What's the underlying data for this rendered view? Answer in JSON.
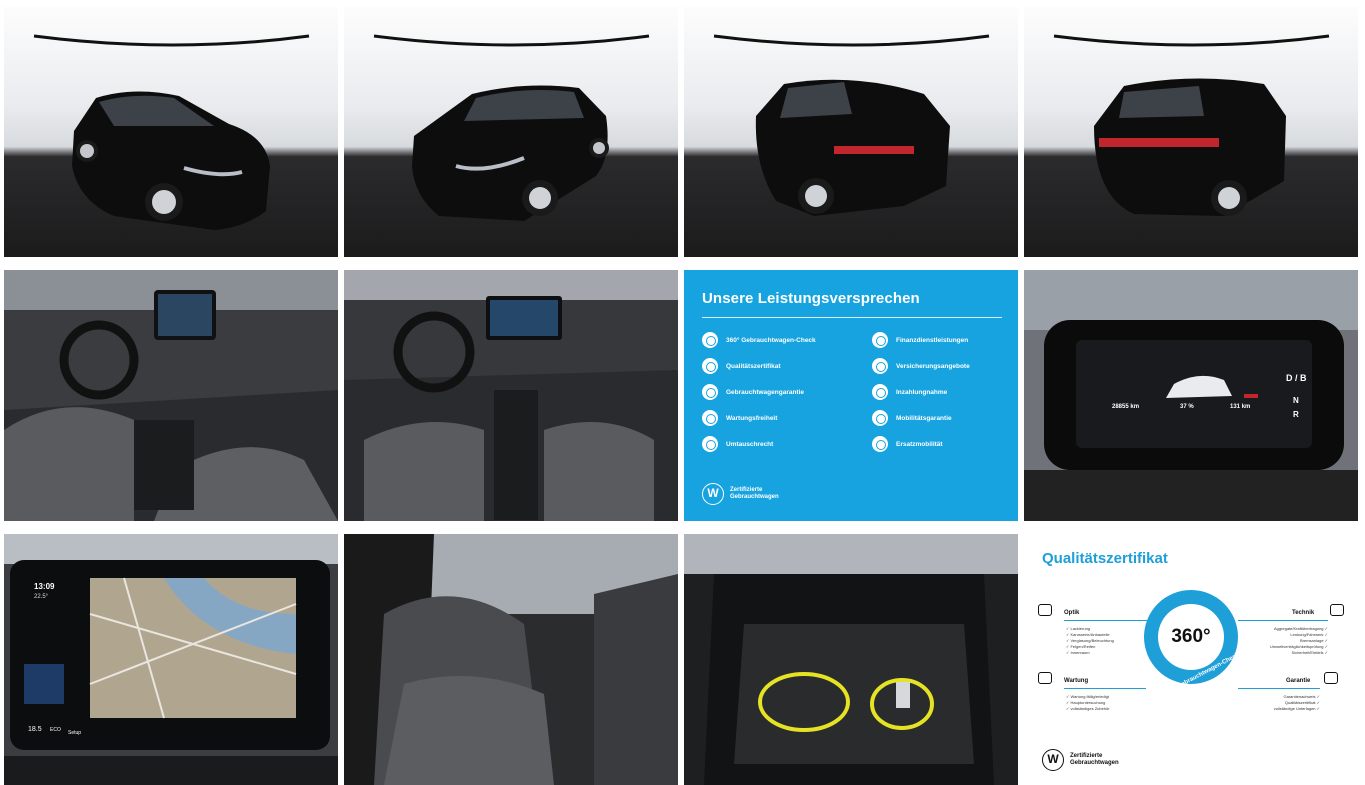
{
  "gallery": {
    "tiles": [
      {
        "name": "exterior-front-left"
      },
      {
        "name": "exterior-front-right"
      },
      {
        "name": "exterior-rear-left"
      },
      {
        "name": "exterior-rear-right"
      },
      {
        "name": "interior-dashboard-driver"
      },
      {
        "name": "interior-cockpit"
      },
      {
        "name": "promise-card"
      },
      {
        "name": "instrument-display"
      },
      {
        "name": "infotainment-map"
      },
      {
        "name": "rear-seats"
      },
      {
        "name": "trunk-cables"
      },
      {
        "name": "certificate-card"
      }
    ]
  },
  "cockpit": {
    "odometer": "28855",
    "odometer_unit": "km",
    "battery": "37 %",
    "range": "131",
    "range_unit": "km",
    "gear_top": "D / B",
    "gear_n": "N",
    "gear_r": "R"
  },
  "nav": {
    "time": "13:09",
    "temp": "22.5°",
    "left_temp": "18.5",
    "eco": "ECO",
    "setup": "Setup"
  },
  "promise": {
    "title": "Unsere Leistungsversprechen",
    "left": [
      "360° Gebrauchtwagen-Check",
      "Qualitätszertifikat",
      "Gebrauchtwagengarantie",
      "Wartungsfreiheit",
      "Umtauschrecht"
    ],
    "right": [
      "Finanzdienstleistungen",
      "Versicherungsangebote",
      "Inzahlungnahme",
      "Mobilitätsgarantie",
      "Ersatzmobilität"
    ],
    "brand": "Zertifizierte\nGebrauchtwagen"
  },
  "certificate": {
    "title": "Qualitätszertifikat",
    "optik": "Optik",
    "optik_items": [
      "✓ Lackierung",
      "✓ Karosserie/Anbauteile",
      "✓ Verglasung/Beleuchtung",
      "✓ Felgen/Reifen",
      "✓ Innenraum"
    ],
    "technik": "Technik",
    "technik_items": [
      "Aggregate/Kraftübertragung ✓",
      "Lenkung/Fahrwerk ✓",
      "Bremsanlage ✓",
      "Umweltverträglichkeitsprüfung ✓",
      "Sicherheit/Elektrik ✓"
    ],
    "wartung": "Wartung",
    "wartung_items": [
      "✓ Wartung fällig/erledigt",
      "✓ Hauptuntersuchung",
      "✓ vollständiges Zubehör"
    ],
    "garantie": "Garantie",
    "garantie_items": [
      "Garantienachweis ✓",
      "Qualitätszertifikat ✓",
      "vollständige Unterlagen ✓"
    ],
    "badge": "360°",
    "badge_arc": "Gebrauchtwagen-Check",
    "brand": "Zertifizierte\nGebrauchtwagen"
  }
}
